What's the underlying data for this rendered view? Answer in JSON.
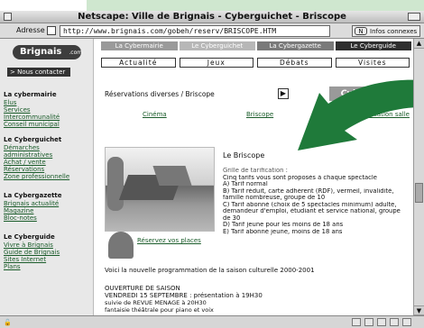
{
  "window": {
    "title": "Netscape: Ville de Brignais - Cyberguichet - Briscope"
  },
  "address_bar": {
    "label": "Adresse",
    "url": "http://www.brignais.com/gobeh/reserv/BRISCOPE.HTM",
    "info_button": "Infos connexes",
    "info_icon": "N"
  },
  "sidebar": {
    "logo": "Brignais",
    "logo_suffix": ".com",
    "contact": "> Nous contacter",
    "sections": [
      {
        "heading": "La cybermairie",
        "links": [
          "Elus",
          "Services",
          "Intercommunalité",
          "Conseil municipal"
        ]
      },
      {
        "heading": "Le Cyberguichet",
        "links": [
          "Démarches",
          "administratives",
          "Achat / vente",
          "Réservations",
          "Zone professionnelle"
        ]
      },
      {
        "heading": "La Cybergazette",
        "links": [
          "Brignais actualité",
          "Magazine",
          "Bloc-notes"
        ]
      },
      {
        "heading": "Le Cyberguide",
        "links": [
          "Vivre à Brignais",
          "Guide de Brignais",
          "Sites Internet",
          "Plans"
        ]
      }
    ]
  },
  "nav_top": {
    "items": [
      {
        "label": "La Cybermairie",
        "color": "#9a9a9a"
      },
      {
        "label": "Le Cyberguichet",
        "color": "#b7b7b7"
      },
      {
        "label": "La Cybergazette",
        "color": "#7a7a7a"
      },
      {
        "label": "Le Cyberguide",
        "color": "#2f2f2f"
      }
    ]
  },
  "nav_sub": {
    "items": [
      "Actualité",
      "Jeux",
      "Débats",
      "Visites"
    ]
  },
  "main": {
    "breadcrumb": "Réservations diverses / Briscope",
    "arrow_icon": "▶",
    "cyber_button": "Cyberguichet",
    "tabs": [
      "Cinéma",
      "Briscope",
      "Location salle"
    ],
    "title": "Le Briscope",
    "tarifs": [
      "Grille de tarification :",
      "Cinq tarifs vous sont proposés à chaque spectacle",
      "A) Tarif normal",
      "B) Tarif réduit, carte adhérent (RDF), vermeil, invalidité,",
      "famille nombreuse, groupe de 10",
      "C) Tarif abonné (choix de 5 spectacles minimum) adulte,",
      "demandeur d'emploi, étudiant et service national, groupe",
      "de 30",
      "D) Tarif jeune pour les moins de 18 ans",
      "E) Tarif abonné jeune, moins de 18 ans"
    ],
    "reserve_link": "Réservez vos places",
    "programme": "Voici la nouvelle programmation de la saison culturelle 2000-2001",
    "opening": [
      "OUVERTURE DE SAISON",
      "VENDREDI 15 SEPTEMBRE : présentation à 19H30",
      "suivie de REVUE MENAGE à 20H30",
      "fantaisie théâtrale pour piano et voix"
    ]
  },
  "colors": {
    "arrow_green": "#1f7a3a",
    "banner_green": "#cfe7cf",
    "link_green": "#1a5c2a"
  }
}
